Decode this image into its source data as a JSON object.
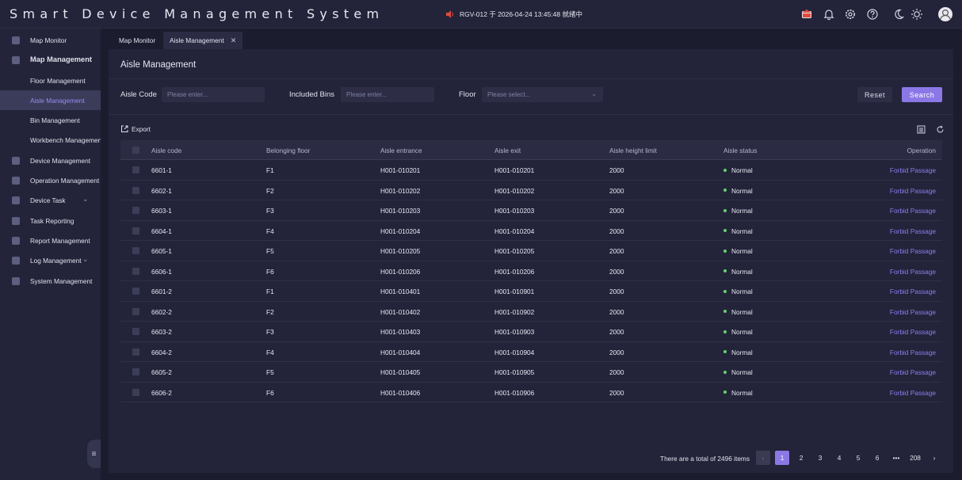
{
  "app": {
    "title": "Smart Device Management System"
  },
  "header": {
    "alert_text": "RGV-012 于 2026-04-24 13:45:48 就绪中",
    "icons": [
      "speaker-icon",
      "alert-badge-icon",
      "bell-icon",
      "gear-icon",
      "help-icon",
      "moon-icon",
      "sun-icon",
      "avatar"
    ]
  },
  "sidebar": {
    "items": [
      {
        "label": "Map Monitor",
        "icon": "map-icon"
      },
      {
        "label": "Map Management",
        "icon": "building-icon"
      },
      {
        "label": "Floor Management"
      },
      {
        "label": "Aisle Management"
      },
      {
        "label": "Bin Management"
      },
      {
        "label": "Workbench Management"
      },
      {
        "label": "Device Management",
        "icon": "device-icon"
      },
      {
        "label": "Operation Management",
        "icon": "operation-icon"
      },
      {
        "label": "Device Task",
        "icon": "task-icon"
      },
      {
        "label": "Task Reporting",
        "icon": "report-icon"
      },
      {
        "label": "Report Management",
        "icon": "chart-icon"
      },
      {
        "label": "Log Management",
        "icon": "log-icon"
      },
      {
        "label": "System Management",
        "icon": "system-icon"
      }
    ]
  },
  "tabs": [
    {
      "label": "Map Monitor"
    },
    {
      "label": "Aisle Management"
    }
  ],
  "page": {
    "title": "Aisle Management"
  },
  "filters": {
    "aisle_code_label": "Aisle Code",
    "aisle_code_placeholder": "Please enter...",
    "bins_label": "Included Bins",
    "bins_placeholder": "Please enter...",
    "floor_label": "Floor",
    "floor_placeholder": "Please select...",
    "reset": "Reset",
    "search": "Search"
  },
  "toolbar": {
    "export": "Export"
  },
  "table": {
    "headers": [
      "Aisle code",
      "Belonging floor",
      "Aisle entrance",
      "Aisle exit",
      "Aisle height limit",
      "Aisle status",
      "Operation"
    ],
    "rows": [
      [
        "6601-1",
        "F1",
        "H001-010201",
        "H001-010201",
        "2000",
        "Normal",
        "Forbid Passage"
      ],
      [
        "6602-1",
        "F2",
        "H001-010202",
        "H001-010202",
        "2000",
        "Normal",
        "Forbid Passage"
      ],
      [
        "6603-1",
        "F3",
        "H001-010203",
        "H001-010203",
        "2000",
        "Normal",
        "Forbid Passage"
      ],
      [
        "6604-1",
        "F4",
        "H001-010204",
        "H001-010204",
        "2000",
        "Normal",
        "Forbid Passage"
      ],
      [
        "6605-1",
        "F5",
        "H001-010205",
        "H001-010205",
        "2000",
        "Normal",
        "Forbid Passage"
      ],
      [
        "6606-1",
        "F6",
        "H001-010206",
        "H001-010206",
        "2000",
        "Normal",
        "Forbid Passage"
      ],
      [
        "6601-2",
        "F1",
        "H001-010401",
        "H001-010901",
        "2000",
        "Normal",
        "Forbid Passage"
      ],
      [
        "6602-2",
        "F2",
        "H001-010402",
        "H001-010902",
        "2000",
        "Normal",
        "Forbid Passage"
      ],
      [
        "6603-2",
        "F3",
        "H001-010403",
        "H001-010903",
        "2000",
        "Normal",
        "Forbid Passage"
      ],
      [
        "6604-2",
        "F4",
        "H001-010404",
        "H001-010904",
        "2000",
        "Normal",
        "Forbid Passage"
      ],
      [
        "6605-2",
        "F5",
        "H001-010405",
        "H001-010905",
        "2000",
        "Normal",
        "Forbid Passage"
      ],
      [
        "6606-2",
        "F6",
        "H001-010406",
        "H001-010906",
        "2000",
        "Normal",
        "Forbid Passage"
      ]
    ]
  },
  "pagination": {
    "total_text": "There are a total of 2496 items",
    "pages": [
      "1",
      "2",
      "3",
      "4",
      "5",
      "6",
      "•••",
      "208"
    ],
    "current": "1"
  },
  "colors": {
    "accent": "#8b78e6",
    "link": "#8b7ff0",
    "status_normal": "#63d26b",
    "alert": "#e04a3c"
  }
}
